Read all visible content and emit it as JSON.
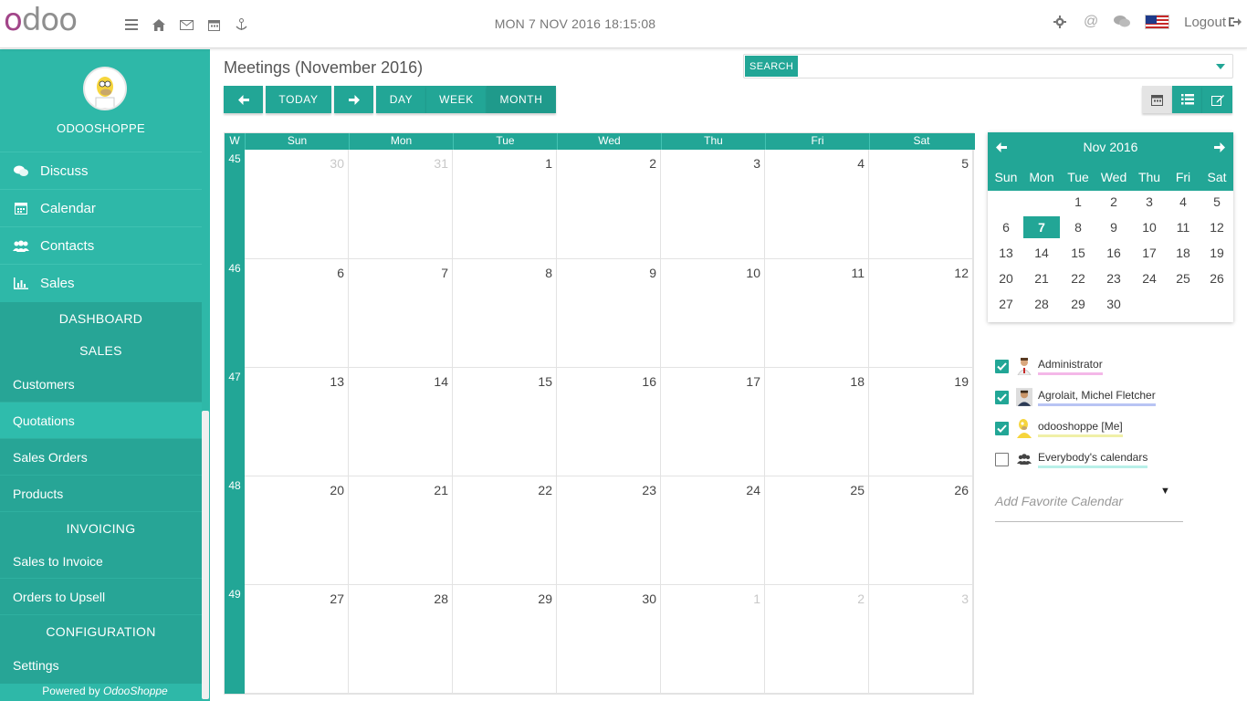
{
  "topbar": {
    "logo": "odoo",
    "icons": [
      "menu-icon",
      "home-icon",
      "envelope-icon",
      "calendar-icon",
      "anchor-icon"
    ],
    "datetime": "MON 7 NOV 2016 18:15:08",
    "logout": "Logout",
    "right_icons": [
      "gear-icon",
      "at-icon",
      "comments-icon",
      "us-flag-icon",
      "sign-out-icon"
    ]
  },
  "sidebar": {
    "user": "ODOOSHOPPE",
    "items": [
      {
        "label": "Discuss",
        "icon": "comments-icon"
      },
      {
        "label": "Calendar",
        "icon": "calendar-icon"
      },
      {
        "label": "Contacts",
        "icon": "users-icon"
      },
      {
        "label": "Sales",
        "icon": "bar-chart-icon"
      }
    ],
    "sections": {
      "dashboard": "DASHBOARD",
      "sales": "SALES",
      "invoicing": "INVOICING",
      "configuration": "CONFIGURATION"
    },
    "sales_items": [
      "Customers",
      "Quotations",
      "Sales Orders",
      "Products"
    ],
    "active_item": "Quotations",
    "invoicing_items": [
      "Sales to Invoice",
      "Orders to Upsell"
    ],
    "config_items": [
      "Settings"
    ],
    "powered_prefix": "Powered by ",
    "powered_brand": "OdooShoppe"
  },
  "main": {
    "title": "Meetings (November 2016)",
    "search_label": "SEARCH",
    "buttons": {
      "today": "TODAY",
      "day": "DAY",
      "week": "WEEK",
      "month": "MONTH"
    },
    "active_view": "MONTH",
    "view_switch": [
      "calendar-view-icon",
      "list-view-icon",
      "form-view-icon"
    ]
  },
  "month": {
    "week_header": "W",
    "day_names": [
      "Sun",
      "Mon",
      "Tue",
      "Wed",
      "Thu",
      "Fri",
      "Sat"
    ],
    "weeks": [
      {
        "num": "45",
        "days": [
          "30",
          "31",
          "1",
          "2",
          "3",
          "4",
          "5"
        ],
        "other": [
          true,
          true,
          false,
          false,
          false,
          false,
          false
        ]
      },
      {
        "num": "46",
        "days": [
          "6",
          "7",
          "8",
          "9",
          "10",
          "11",
          "12"
        ],
        "other": [
          false,
          false,
          false,
          false,
          false,
          false,
          false
        ]
      },
      {
        "num": "47",
        "days": [
          "13",
          "14",
          "15",
          "16",
          "17",
          "18",
          "19"
        ],
        "other": [
          false,
          false,
          false,
          false,
          false,
          false,
          false
        ]
      },
      {
        "num": "48",
        "days": [
          "20",
          "21",
          "22",
          "23",
          "24",
          "25",
          "26"
        ],
        "other": [
          false,
          false,
          false,
          false,
          false,
          false,
          false
        ]
      },
      {
        "num": "49",
        "days": [
          "27",
          "28",
          "29",
          "30",
          "1",
          "2",
          "3"
        ],
        "other": [
          false,
          false,
          false,
          false,
          true,
          true,
          true
        ]
      }
    ]
  },
  "mini_calendar": {
    "title": "Nov 2016",
    "dow": [
      "Sun",
      "Mon",
      "Tue",
      "Wed",
      "Thu",
      "Fri",
      "Sat"
    ],
    "rows": [
      [
        "",
        "",
        "1",
        "2",
        "3",
        "4",
        "5"
      ],
      [
        "6",
        "7",
        "8",
        "9",
        "10",
        "11",
        "12"
      ],
      [
        "13",
        "14",
        "15",
        "16",
        "17",
        "18",
        "19"
      ],
      [
        "20",
        "21",
        "22",
        "23",
        "24",
        "25",
        "26"
      ],
      [
        "27",
        "28",
        "29",
        "30",
        "",
        "",
        ""
      ]
    ],
    "today": "7"
  },
  "filters": [
    {
      "label": "Administrator",
      "checked": true,
      "underline": "#f4b8e8"
    },
    {
      "label": "Agrolait, Michel Fletcher",
      "checked": true,
      "underline": "#b8c4f4"
    },
    {
      "label": "odooshoppe [Me]",
      "checked": true,
      "underline": "#f0f0a8"
    },
    {
      "label": "Everybody's calendars",
      "checked": false,
      "underline": "#b8f0e8"
    }
  ],
  "favorite": {
    "placeholder": "Add Favorite Calendar"
  },
  "colors": {
    "accent": "#22a696",
    "sidebar": "#2eb8a8",
    "brand": "#a24689"
  }
}
